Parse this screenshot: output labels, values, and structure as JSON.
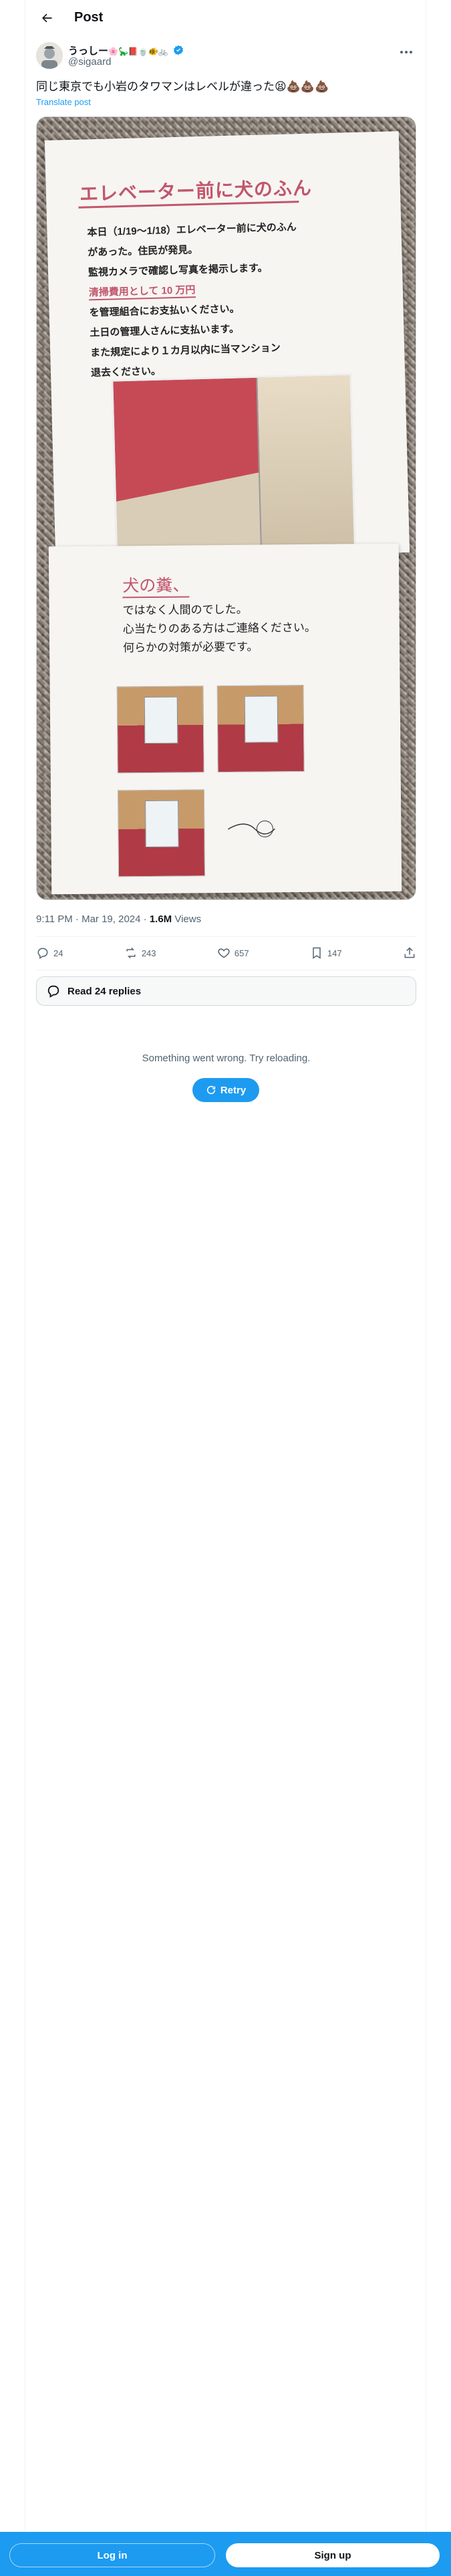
{
  "header": {
    "title": "Post"
  },
  "author": {
    "name": "うっしー",
    "emoji": "🌸🦕📕🍵🐠🚲",
    "handle": "@sigaard"
  },
  "post": {
    "text": "同じ東京でも小岩のタワマンはレベルが違った😫💩💩💩",
    "translate_label": "Translate post",
    "timestamp": "9:11 PM · Mar 19, 2024 · ",
    "views_count": "1.6M",
    "views_label": " Views"
  },
  "media": {
    "poster1": {
      "title": "エレベーター前に犬のふん",
      "lines": [
        "本日（1/19～1/18）エレベーター前に犬のふん",
        "があった。住民が発見。",
        "監視カメラで確認し写真を掲示します。",
        "清掃費用として 10 万円",
        "を管理組合にお支払いください。",
        "土日の管理人さんに支払います。",
        "また規定により１カ月以内に当マンション",
        "退去ください。"
      ]
    },
    "poster2": {
      "title": "犬の糞、",
      "lines": [
        "ではなく人間のでした。",
        "心当たりのある方はご連絡ください。",
        "何らかの対策が必要です。"
      ]
    }
  },
  "actions": {
    "replies": "24",
    "reposts": "243",
    "likes": "657",
    "bookmarks": "147"
  },
  "read_replies_label": "Read 24 replies",
  "error": {
    "message": "Something went wrong. Try reloading.",
    "retry_label": "Retry"
  },
  "bottom_bar": {
    "login_label": "Log in",
    "signup_label": "Sign up"
  },
  "colors": {
    "accent": "#1d9bf0",
    "text": "#0f1419",
    "muted": "#536471"
  }
}
